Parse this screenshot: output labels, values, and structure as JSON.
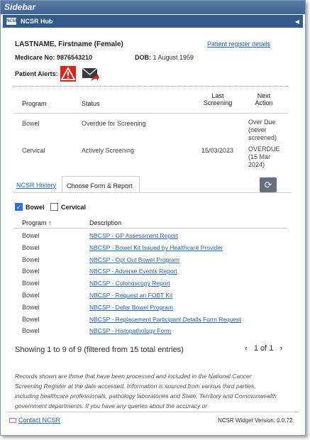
{
  "window": {
    "title": "Sidebar"
  },
  "hub": {
    "title": "NCSR Hub",
    "logo_text": "NCSR"
  },
  "patient": {
    "name": "LASTNAME, Firstname (Female)",
    "register_link": "Patient register details",
    "medicare_label": "Medicare No:",
    "medicare_no": "9876543210",
    "dob_label": "DOB:",
    "dob": "1 August 1959",
    "alerts_label": "Patient Alerts:"
  },
  "program_table": {
    "headers": {
      "program": "Program",
      "status": "Status",
      "last_screening": "Last Screening",
      "next_action": "Next Action"
    },
    "rows": [
      {
        "program": "Bowel",
        "status": "Overdue for Screening",
        "last_screening": "",
        "next_action": "Over Due (never screened)"
      },
      {
        "program": "Cervical",
        "status": "Actively Screening",
        "last_screening": "15/03/2023",
        "next_action": "OVERDUE (15 Mar 2024)"
      }
    ]
  },
  "tabs": {
    "history": "NCSR History",
    "forms": "Choose Form & Report"
  },
  "filters": {
    "bowel": "Bowel",
    "cervical": "Cervical"
  },
  "forms_table": {
    "headers": {
      "program": "Program",
      "sort_arrow": "↑",
      "description": "Description"
    },
    "rows": [
      {
        "program": "Bowel",
        "description": "NBCSP - GP Assessment Report"
      },
      {
        "program": "Bowel",
        "description": "NBCSP - Bowel Kit Issued by Healthcare Provider"
      },
      {
        "program": "Bowel",
        "description": "NBCSP - Opt Out Bowel Program"
      },
      {
        "program": "Bowel",
        "description": "NBCSP - Adverse Events Report"
      },
      {
        "program": "Bowel",
        "description": "NBCSP - Colonoscopy Report"
      },
      {
        "program": "Bowel",
        "description": "NBCSP - Request an FOBT Kit"
      },
      {
        "program": "Bowel",
        "description": "NBCSP - Defer Bowel Program"
      },
      {
        "program": "Bowel",
        "description": "NBCSP - Replacement Participant Details Form Request"
      },
      {
        "program": "Bowel",
        "description": "NBCSP - Histopathology Form"
      }
    ]
  },
  "pagination": {
    "summary": "Showing 1 to 9 of 9 (filtered from 15 total entries)",
    "page": "1 of 1",
    "prev": "‹",
    "next": "›"
  },
  "disclaimer": "Records shown are those that have been processed and included in the National Cancer Screening Register at the date accessed. Information is sourced from various third parties, including healthcare professionals, pathology laboratories and State, Territory and Commonwealth government departments. If you have any queries about the accuracy or",
  "footer": {
    "contact": "Contact NCSR",
    "version": "NCSR Widget Version: 0.0.72"
  }
}
